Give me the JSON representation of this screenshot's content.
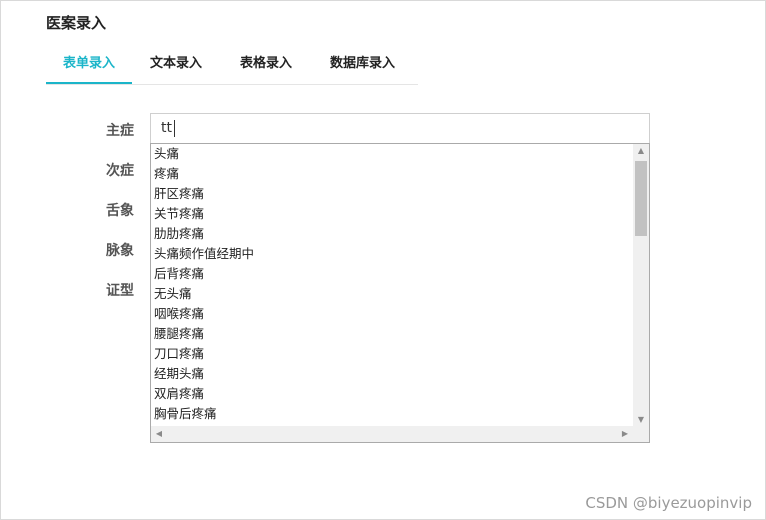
{
  "page": {
    "title": "医案录入"
  },
  "tabs": [
    {
      "label": "表单录入",
      "active": true
    },
    {
      "label": "文本录入",
      "active": false
    },
    {
      "label": "表格录入",
      "active": false
    },
    {
      "label": "数据库录入",
      "active": false
    }
  ],
  "form": {
    "labels": [
      "主症",
      "次症",
      "舌象",
      "脉象",
      "证型"
    ],
    "main_input_value": "tt"
  },
  "suggestions": [
    "头痛",
    "疼痛",
    "肝区疼痛",
    "关节疼痛",
    "肋肋疼痛",
    "头痛频作值经期中",
    "后背疼痛",
    "无头痛",
    "咽喉疼痛",
    "腰腿疼痛",
    "刀口疼痛",
    "经期头痛",
    "双肩疼痛",
    "胸骨后疼痛"
  ],
  "scroll": {
    "up": "▲",
    "down": "▼",
    "left": "◀",
    "right": "▶"
  },
  "watermark": "CSDN @biyezuopinvip",
  "colors": {
    "accent": "#1bb5c9"
  }
}
